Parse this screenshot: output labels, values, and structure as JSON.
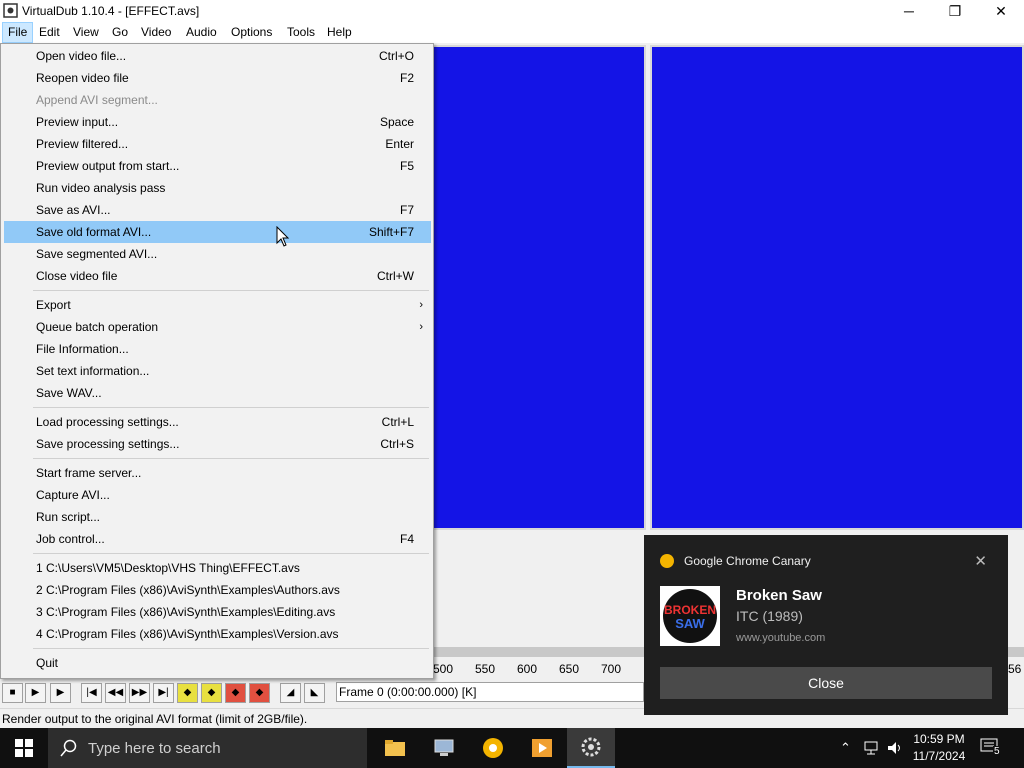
{
  "window": {
    "title": "VirtualDub 1.10.4 - [EFFECT.avs]",
    "minimize_glyph": "─",
    "restore_glyph": "❐",
    "close_glyph": "✕"
  },
  "menubar": [
    "File",
    "Edit",
    "View",
    "Go",
    "Video",
    "Audio",
    "Options",
    "Tools",
    "Help"
  ],
  "file_menu": {
    "items": [
      {
        "label": "Open video file...",
        "shortcut": "Ctrl+O"
      },
      {
        "label": "Reopen video file",
        "shortcut": "F2"
      },
      {
        "label": "Append AVI segment...",
        "shortcut": "",
        "disabled": true
      },
      {
        "label": "Preview input...",
        "shortcut": "Space"
      },
      {
        "label": "Preview filtered...",
        "shortcut": "Enter"
      },
      {
        "label": "Preview output from start...",
        "shortcut": "F5"
      },
      {
        "label": "Run video analysis pass",
        "shortcut": ""
      },
      {
        "label": "Save as AVI...",
        "shortcut": "F7"
      },
      {
        "label": "Save old format AVI...",
        "shortcut": "Shift+F7",
        "highlighted": true
      },
      {
        "label": "Save segmented AVI...",
        "shortcut": ""
      },
      {
        "label": "Close video file",
        "shortcut": "Ctrl+W"
      },
      {
        "label": "Export",
        "shortcut": "",
        "submenu": true
      },
      {
        "label": "Queue batch operation",
        "shortcut": "",
        "submenu": true
      },
      {
        "label": "File Information...",
        "shortcut": ""
      },
      {
        "label": "Set text information...",
        "shortcut": ""
      },
      {
        "label": "Save WAV...",
        "shortcut": ""
      },
      {
        "label": "Load processing settings...",
        "shortcut": "Ctrl+L"
      },
      {
        "label": "Save processing settings...",
        "shortcut": "Ctrl+S"
      },
      {
        "label": "Start frame server...",
        "shortcut": ""
      },
      {
        "label": "Capture AVI...",
        "shortcut": ""
      },
      {
        "label": "Run script...",
        "shortcut": ""
      },
      {
        "label": "Job control...",
        "shortcut": "F4"
      },
      {
        "label": "1 C:\\Users\\VM5\\Desktop\\VHS Thing\\EFFECT.avs",
        "shortcut": ""
      },
      {
        "label": "2 C:\\Program Files (x86)\\AviSynth\\Examples\\Authors.avs",
        "shortcut": ""
      },
      {
        "label": "3 C:\\Program Files (x86)\\AviSynth\\Examples\\Editing.avs",
        "shortcut": ""
      },
      {
        "label": "4 C:\\Program Files (x86)\\AviSynth\\Examples\\Version.avs",
        "shortcut": ""
      },
      {
        "label": "Quit",
        "shortcut": ""
      }
    ]
  },
  "timeline": {
    "ticks": [
      "500",
      "550",
      "600",
      "650",
      "700",
      "56"
    ]
  },
  "position": {
    "frame_text": "Frame 0 (0:00:00.000) [K]"
  },
  "status": {
    "text": "Render output to the original AVI format (limit of 2GB/file)."
  },
  "notification": {
    "app_name": "Google Chrome Canary",
    "title": "Broken Saw",
    "subtitle": "ITC (1989)",
    "source": "www.youtube.com",
    "close_label": "Close",
    "dismiss_glyph": "✕",
    "thumb_text_1": "BROKEN",
    "thumb_text_2": "SAW"
  },
  "taskbar": {
    "search_placeholder": "Type here to search",
    "time": "10:59 PM",
    "date": "11/7/2024",
    "notification_count": "5"
  },
  "colors": {
    "preview_blue": "#1414e6",
    "menu_highlight": "#91c9f7",
    "toast_bg": "#1f1f1f"
  }
}
